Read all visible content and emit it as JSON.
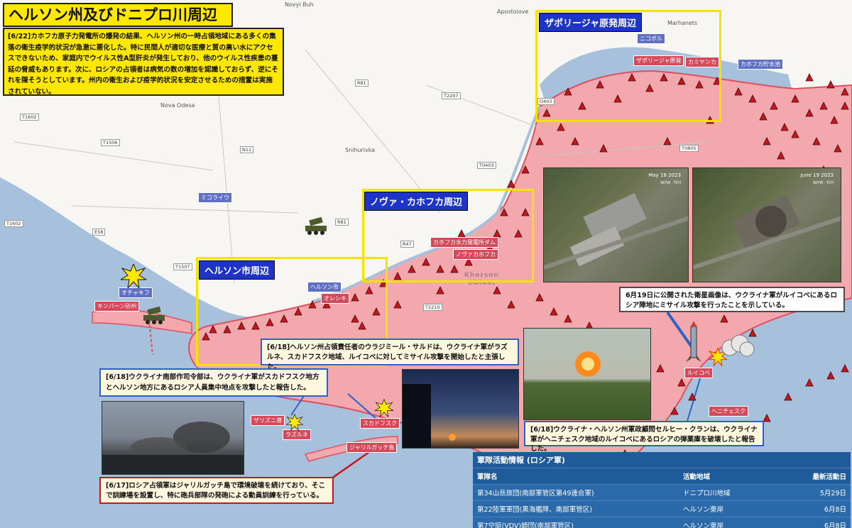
{
  "title": "ヘルソン州及びドニプロ川周辺地域",
  "intro_note": "[6/22]カホフカ原子力発電所の爆発の結果、ヘルソン州の一時占領地域にある多くの集落の衛生疫学的状況が急激に悪化した。特に民間人が適切な医療と質の高い水にアクセスできないため、家庭内でウイルス性A型肝炎が発生しており、他のウイルス性疾患の蔓延の脅威もあります。次に、ロシアの占領者は病気の数の増加を認識しておらず、逆にそれを隠そうとしています。州内の衛生および疫学的状況を安定させるための措置は実施されていない。",
  "areas": {
    "zaporizhzhia": "ザポリージャ原発周辺",
    "nova_kakhovka": "ノヴァ・カホフカ周辺",
    "kherson": "ヘルソン市周辺"
  },
  "places": {
    "novyi_buh": "Novyi Buh",
    "apostolove": "Apostolove",
    "marhanets": "Marhanets",
    "nova_odesa": "Nova Odesa",
    "snihurivka": "Snihurivka",
    "oblast_line1": "Kherson",
    "oblast_line2": "Oblast"
  },
  "roads": [
    "T1602",
    "T1506",
    "N11",
    "R81",
    "T2207",
    "O403",
    "T0805",
    "T0403",
    "T1602",
    "E58",
    "R81",
    "R47",
    "T1507",
    "T2210"
  ],
  "labels_red": {
    "enerhodar": "ザポリージャ原発",
    "kamianka": "カミヤンカ",
    "kakhovka_dam": "カホフカ水力発電所ダム",
    "nova_kakhovka": "ノヴァカホフカ",
    "oleshky": "オレシキ",
    "kinburn": "キンバーン砂州",
    "zaliznyi": "ザリズニ港",
    "hola": "ラズルネ",
    "skadovsk": "スカドフスク",
    "dzharylhach": "ジャリルガッチ島",
    "rykove": "ルイコベ",
    "henichesk": "ヘニチェスク"
  },
  "labels_blue": {
    "nikopol": "ニコポル",
    "kherson": "ヘルソン市",
    "mykolaiv": "ミコライウ",
    "ochakiv": "オチャキフ",
    "reservoir": "カホフカ貯水池"
  },
  "satellite": {
    "date1": "May 18 2023",
    "date2": "June 19 2023",
    "tag": "SKYW · TCH"
  },
  "callouts": {
    "satellite_note": "6月19日に公開された衛星画像は、ウクライナ軍がルイコベにあるロシア陣地にミサイル攻撃を行ったことを示している。",
    "saldo": "[6/18]ヘルソン州占領責任者のウラジミール・サルドは、ウクライナ軍がラズルネ、スカドフスク地域、ルイコベに対してミサイル攻撃を開始したと主張した。",
    "south_command": "[6/18]ウクライナ南部作司令部は、ウクライナ軍がスカドフスク地方とヘルソン地方にあるロシア人員集中地点を攻撃したと報告した。",
    "klan": "[6/18]ウクライナ・ヘルソン州軍政顧問セルヒー・クランは、ウクライナ軍がヘニチェスク地域のルイコベにあるロシアの弾薬庫を破壊したと報告した。",
    "dzharylhach": "[6/17]ロシア占領軍はジャリルガッチ島で環境破壊を続けており、そこで訓練場を設置し、特に砲兵部隊の発砲による動員訓練を行っている。"
  },
  "table": {
    "title": "軍隊活動情報 (ロシア軍)",
    "headers": [
      "軍隊名",
      "活動地域",
      "最新活動日"
    ],
    "rows": [
      [
        "第34山岳旅団(南部軍管区第49連合軍)",
        "ドニプロ川地域",
        "5月29日"
      ],
      [
        "第22陸軍軍団(黒海艦隊、南部軍管区)",
        "ヘルソン東岸",
        "6月8日"
      ],
      [
        "第7空挺(VDV)師団(南部軍管区)",
        "ヘルソン東岸",
        "6月8日"
      ]
    ]
  },
  "colors": {
    "occupied": "#f2a8ad",
    "occupied_border": "#e04f5f",
    "water": "#a7c1dc",
    "land": "#f7f6f2",
    "title_bg": "#ffe800",
    "area_title_bg": "#1e34c8",
    "table_bg": "#1f5a9a"
  }
}
